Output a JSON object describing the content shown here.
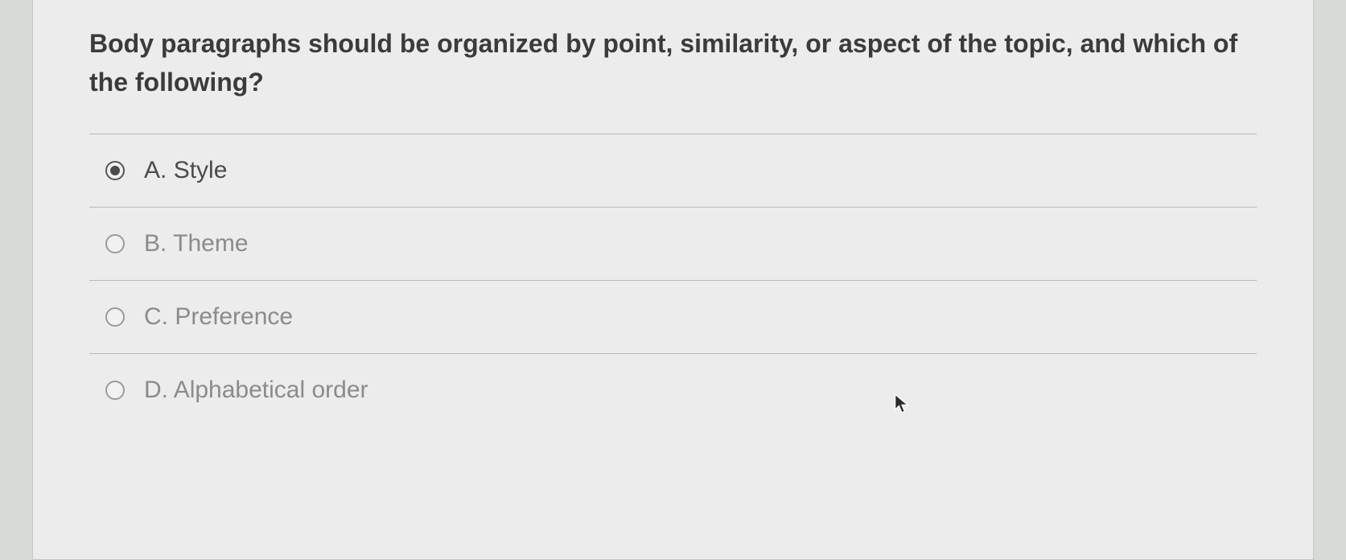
{
  "question": {
    "text": "Body paragraphs should be organized by point, similarity, or aspect of the topic, and which of the following?"
  },
  "options": [
    {
      "letter": "A",
      "text": "Style",
      "selected": true
    },
    {
      "letter": "B",
      "text": "Theme",
      "selected": false
    },
    {
      "letter": "C",
      "text": "Preference",
      "selected": false
    },
    {
      "letter": "D",
      "text": "Alphabetical order",
      "selected": false
    }
  ]
}
